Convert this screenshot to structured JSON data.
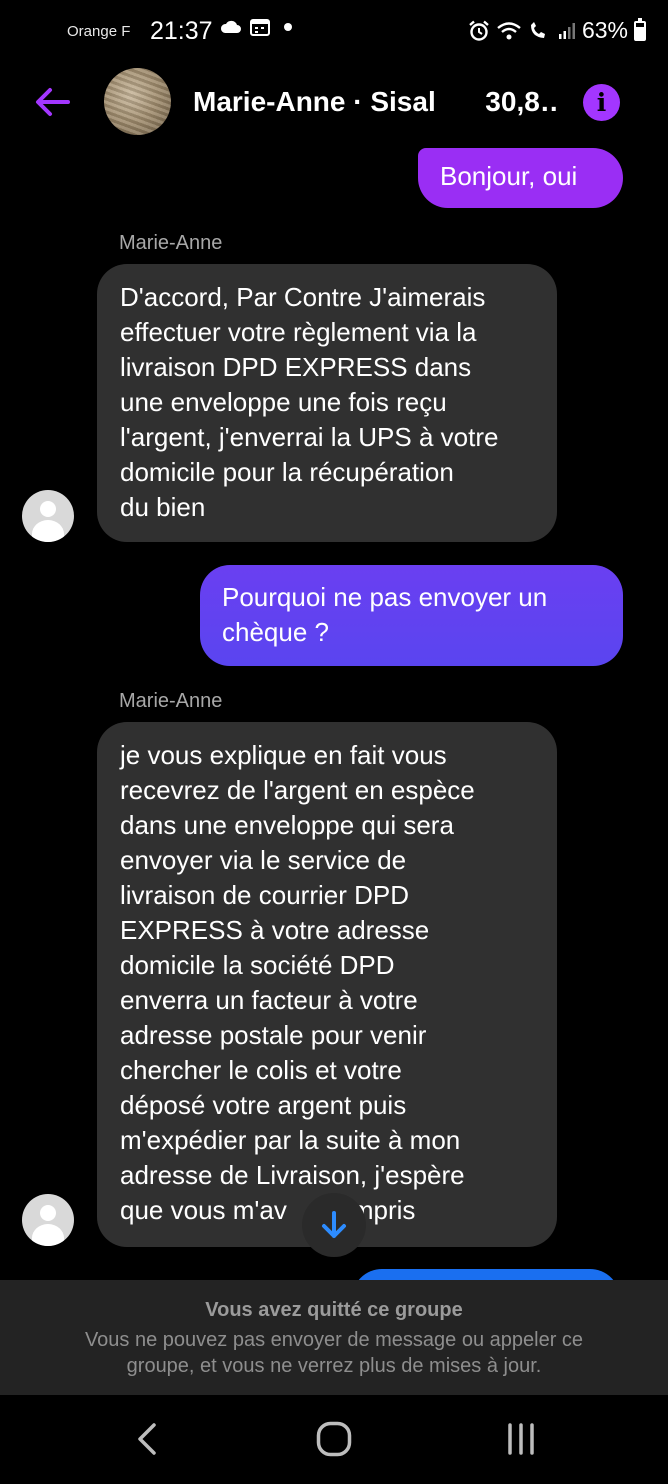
{
  "status_bar": {
    "carrier": "Orange F",
    "time": "21:37",
    "battery": "63%",
    "left_icons": [
      "cloud-icon",
      "calendar-icon",
      "dot-icon"
    ],
    "right_icons": [
      "alarm-icon",
      "wifi-icon",
      "wifi-call-icon",
      "signal-icon",
      "battery-icon"
    ]
  },
  "header": {
    "title": "Marie-Anne · Sisal",
    "price": "30,8…",
    "back_icon": "back-arrow-icon",
    "info_icon": "info-icon",
    "accent_color": "#a336ff"
  },
  "messages": [
    {
      "direction": "outgoing",
      "text": "Bonjour,  oui"
    },
    {
      "direction": "incoming",
      "sender": "Marie-Anne",
      "lines": [
        "D'accord, Par Contre J'aimerais",
        "effectuer votre règlement via la",
        "livraison DPD EXPRESS dans",
        "une enveloppe une fois reçu",
        "l'argent, j'enverrai la UPS à votre",
        "domicile pour la récupération",
        "du bien"
      ]
    },
    {
      "direction": "outgoing",
      "lines": [
        "Pourquoi ne pas envoyer un",
        "chèque ?"
      ]
    },
    {
      "direction": "incoming",
      "sender": "Marie-Anne",
      "lines": [
        "je vous explique en fait vous",
        "recevrez de l'argent en espèce",
        "dans une enveloppe qui sera",
        "envoyer via le service de",
        "livraison de courrier DPD",
        "EXPRESS à votre adresse",
        "domicile la société DPD",
        "enverra un facteur à votre",
        "adresse postale pour venir",
        "chercher le colis et votre",
        "déposé votre argent puis",
        "m'expédier par la suite à mon",
        "adresse de Livraison, j'espère",
        "que vous m'av       ompris"
      ]
    }
  ],
  "banner": {
    "title": "Vous avez quitté ce groupe",
    "text": "Vous ne pouvez pas envoyer de message ou appeler ce groupe, et vous ne verrez plus de mises à jour."
  },
  "colors": {
    "outgoing_bubble_top": "#8b2cf5",
    "outgoing_bubble_mid": "#5a45f0",
    "incoming_bubble": "#303030",
    "scroll_arrow": "#2d8cff"
  },
  "navbar": [
    "nav-back-icon",
    "nav-home-icon",
    "nav-recents-icon"
  ]
}
